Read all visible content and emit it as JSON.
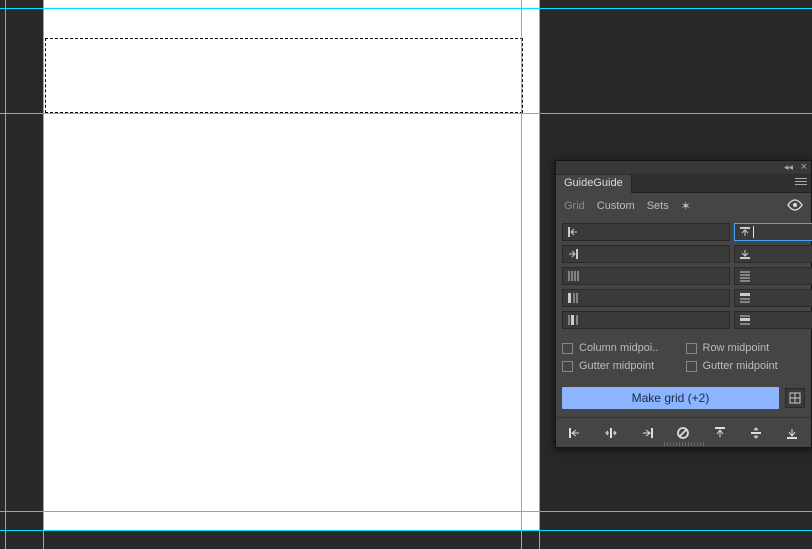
{
  "panel": {
    "title": "GuideGuide",
    "nav": {
      "grid": "Grid",
      "custom": "Custom",
      "sets": "Sets"
    },
    "inputs": {
      "left_margin": "",
      "top_margin": "",
      "right_margin": "",
      "bottom_margin": "",
      "columns": "",
      "rows": "",
      "column_width": "",
      "row_height": "",
      "column_gutter": "",
      "row_gutter": ""
    },
    "checks": {
      "col_mid": "Column midpoi..",
      "row_mid": "Row midpoint",
      "gutter_mid_l": "Gutter midpoint",
      "gutter_mid_r": "Gutter midpoint"
    },
    "button": "Make grid (+2)"
  }
}
